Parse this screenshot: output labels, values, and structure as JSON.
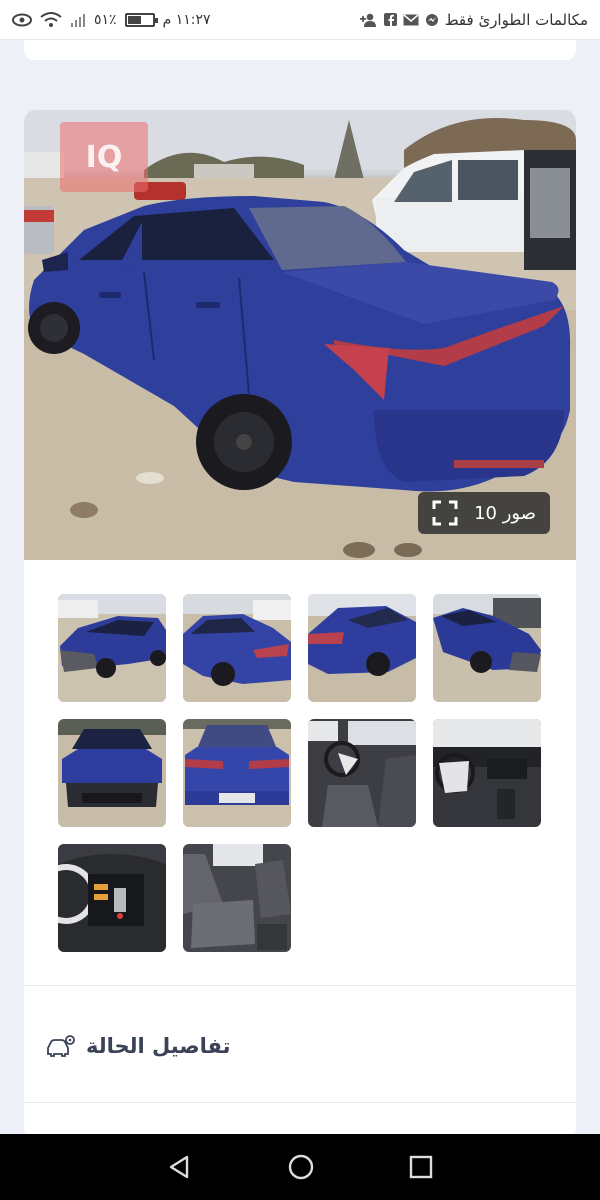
{
  "status_bar": {
    "carrier_text": "مكالمات الطوارئ فقط",
    "time": "١١:٢٧ م",
    "battery_percent": "٥١٪",
    "battery_level": 0.51,
    "icons": [
      "person-add-icon",
      "facebook-icon",
      "mail-icon",
      "messenger-icon",
      "wifi-icon",
      "signal-icon",
      "eye-icon"
    ]
  },
  "hero": {
    "photo_count_label": "صور 10",
    "watermark": "IQ"
  },
  "thumbnails": [
    {
      "scene": "damaged-front-left"
    },
    {
      "scene": "rear-left"
    },
    {
      "scene": "rear-right"
    },
    {
      "scene": "damaged-front-right"
    },
    {
      "scene": "front"
    },
    {
      "scene": "rear"
    },
    {
      "scene": "interior-front"
    },
    {
      "scene": "dashboard"
    },
    {
      "scene": "instrument-cluster"
    },
    {
      "scene": "rear-seats"
    }
  ],
  "details": {
    "title": "تفاصيل الحالة",
    "icon": "car-cog-icon"
  },
  "nav": {
    "back": "back-icon",
    "home": "home-icon",
    "recents": "recents-icon"
  },
  "colors": {
    "accent": "#3b4258",
    "car_blue": "#2f3f9c",
    "background": "#eef0f8"
  }
}
